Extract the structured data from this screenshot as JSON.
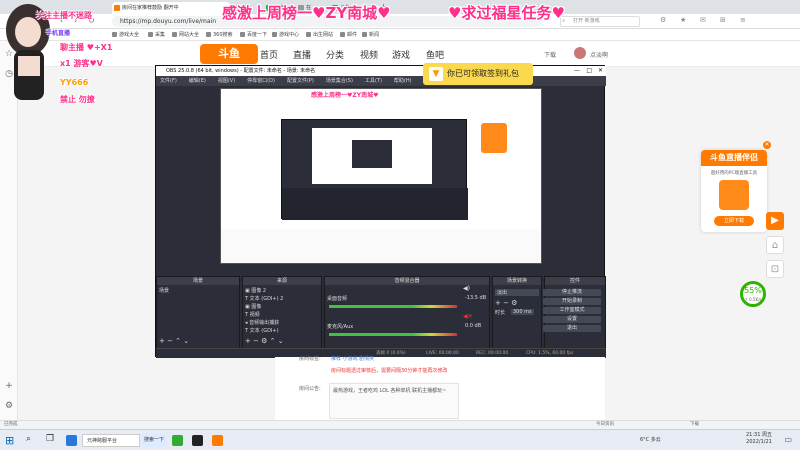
{
  "browser": {
    "tabs": [
      {
        "label": "房间在家推荐鼓励 翻开中"
      },
      {
        "label": "哦"
      },
      {
        "label": "在卖"
      },
      {
        "label": "在"
      },
      {
        "label": ""
      },
      {
        "label": "哦"
      },
      {
        "label": "斗鱼"
      }
    ],
    "url": "https://mp.douyu.com/live/main",
    "search_placeholder": "打开 新游戏",
    "bookmarks": [
      "游戏大全",
      "采集",
      "网站大全",
      "360搜索",
      "百度一下",
      "游戏中心",
      "出生网站",
      "邮件",
      "新闻"
    ]
  },
  "overlay": {
    "headline": "感激上周榜一♥ZY南城♥",
    "headline2": "♥求过福星任务♥",
    "left_texts": [
      "关注主播不迷路",
      "手机直播",
      "♥ X1 游客",
      "♥ 游客",
      "YY666",
      "禁止"
    ],
    "left_lines": [
      "聊主播 ♥+X1",
      "x1 游客♥V",
      "禁止 勿撩"
    ]
  },
  "douyu": {
    "logo": "斗鱼",
    "nav": [
      "首页",
      "直播",
      "分类",
      "视频",
      "游戏",
      "鱼吧"
    ],
    "nav_badge": "斗鱼",
    "download": "下载",
    "user": "点淡啊"
  },
  "obs": {
    "title": "OBS 25.0.8 (64 bit, windows) - 配置文件: 未命名 - 场景: 未命名",
    "menu": [
      "文件(F)",
      "编辑(E)",
      "视图(V)",
      "停靠窗口(D)",
      "配置文件(P)",
      "场景集合(S)",
      "工具(T)",
      "帮助(H)"
    ],
    "docks": {
      "scenes": "场景",
      "sources": "来源",
      "mixer": "音频混合器",
      "transitions": "场景转换",
      "controls": "控件"
    },
    "scene_item": "场景",
    "sources": [
      {
        "name": "图像 2"
      },
      {
        "name": "文本 (GDI+) 2"
      },
      {
        "name": "图像"
      },
      {
        "name": "视频"
      },
      {
        "name": "音频输出捕获"
      },
      {
        "name": "文本 (GDI+)"
      }
    ],
    "mixer": [
      {
        "name": "桌面音频",
        "db": "-13.5 dB"
      },
      {
        "name": "麦克风/Aux",
        "db": "0.0 dB"
      }
    ],
    "transition": "淡出",
    "duration_label": "时长",
    "duration": "300 ms",
    "controls": [
      "停止推流",
      "开始录制",
      "工作室模式",
      "设置",
      "退出"
    ],
    "status": {
      "drops": "丢帧 0 (0.0%)",
      "live": "LIVE: 00:00:00",
      "rec": "REC: 00:00:00",
      "cpu": "CPU: 1.5%, 60.00 fps"
    }
  },
  "gift": "你已可领取签到礼包",
  "promo": {
    "title": "斗鱼直播伴侣",
    "desc": "超好用的PC端直播工具",
    "button": "立即下载"
  },
  "progress": {
    "percent_text": "55%",
    "sub": "↑ 0.5K/s"
  },
  "content": {
    "fields": [
      {
        "label": "房间标签:",
        "value": "推荐 小游戏 剧情类"
      },
      {
        "label": "房间公告:",
        "value": "最热游戏，王者吃鸡 LOL 各种单机 联机主播都玩~"
      }
    ],
    "warning": "房间标题透过审核后，需要间隔30分钟才能再次修改"
  },
  "statusline": "已完成",
  "taskbar": {
    "search": "在这里输入你要搜索的内容",
    "app1": "元神跨服平台",
    "app2": "搜索一下",
    "temp": "6°C 多云",
    "time": "21:31 周五",
    "date": "2022/1/21",
    "download": "下载",
    "news": "今日资讯"
  }
}
